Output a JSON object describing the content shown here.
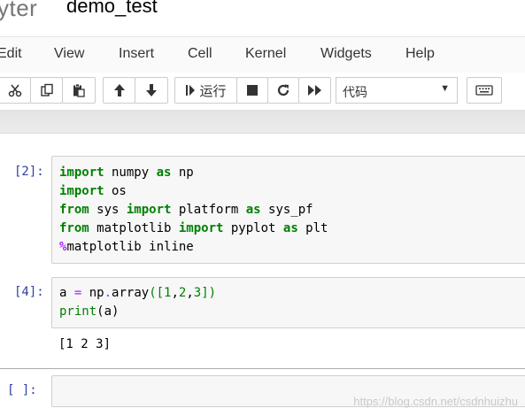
{
  "header": {
    "logo_text": "yter",
    "notebook_name": "demo_test"
  },
  "menubar": {
    "items": [
      "Edit",
      "View",
      "Insert",
      "Cell",
      "Kernel",
      "Widgets",
      "Help"
    ]
  },
  "toolbar": {
    "icons": [
      "cut-icon",
      "copy-icon",
      "paste-icon",
      "move-up-icon",
      "move-down-icon",
      "run-icon",
      "stop-icon",
      "restart-icon",
      "fast-forward-icon",
      "keyboard-icon"
    ],
    "run_label": "运行",
    "cell_type_selected": "代码"
  },
  "cells": [
    {
      "prompt": "[2]:",
      "code": [
        "import numpy as np",
        "import os",
        "from sys import platform as sys_pf",
        "from matplotlib import pyplot as plt",
        "%matplotlib inline"
      ]
    },
    {
      "prompt": "[4]:",
      "code": [
        "a = np.array([1,2,3])",
        "print(a)"
      ],
      "output": "[1 2 3]"
    },
    {
      "prompt": "[ ]:",
      "code": []
    }
  ],
  "watermark": "https://blog.csdn.net/csdnhuizhu"
}
